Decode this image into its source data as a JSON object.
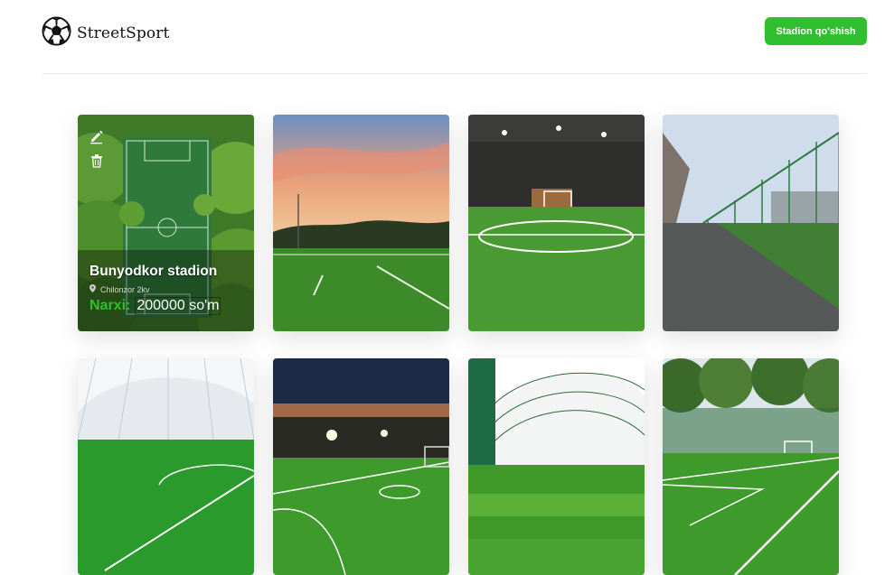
{
  "app": {
    "brand": "StreetSport",
    "add_button_label": "Stadion qo'shish"
  },
  "stadiums": [
    {
      "name": "Bunyodkor stadion",
      "location": "Chilonzor 2kv",
      "price_label": "Narxi:",
      "price_value": "200000 so'm"
    }
  ],
  "icons": {
    "logo": "soccer-ball-icon",
    "edit": "edit-icon",
    "delete": "trash-icon",
    "location": "location-pin-icon"
  },
  "colors": {
    "accent": "#2fbf2f",
    "text": "#111111",
    "divider": "#e6e6e6"
  }
}
